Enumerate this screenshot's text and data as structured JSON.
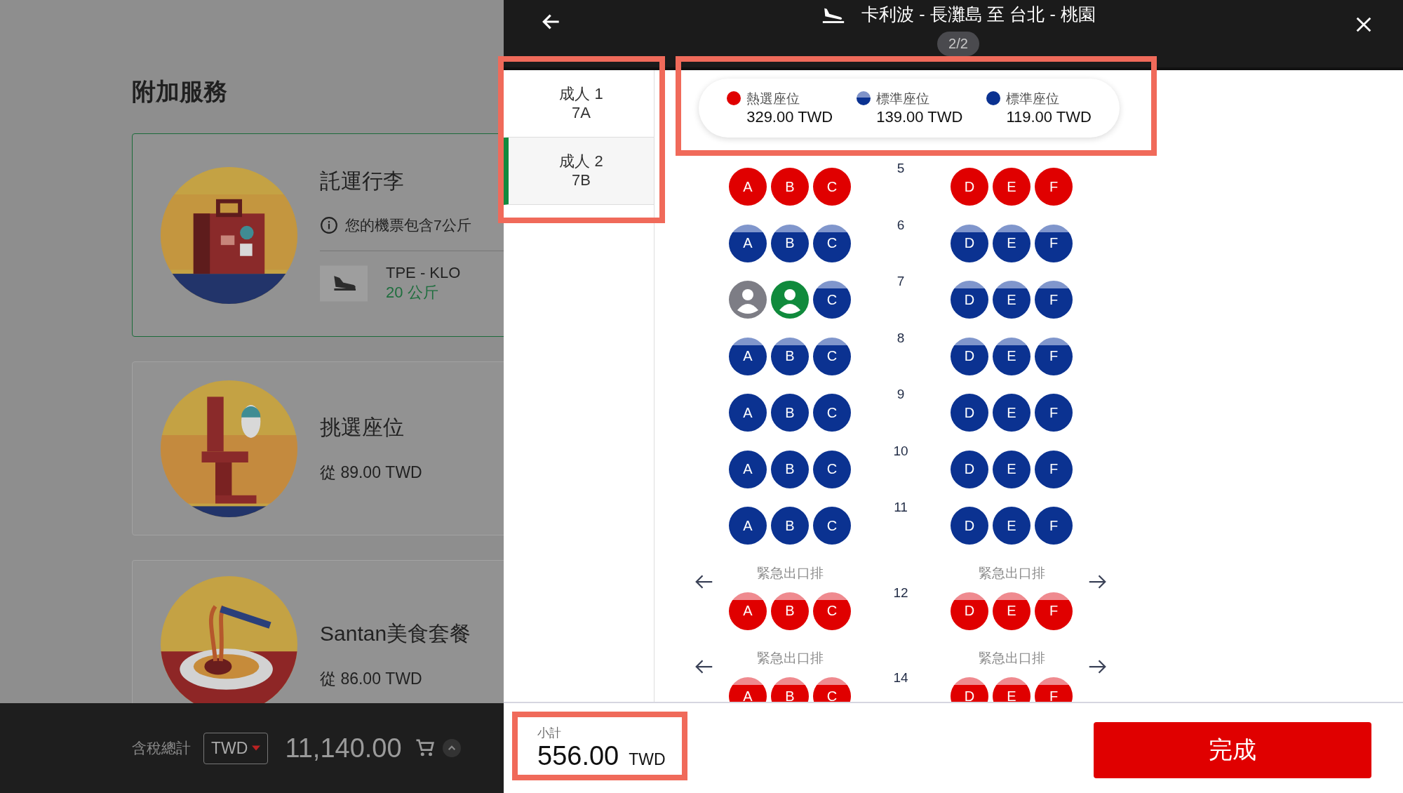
{
  "addons": {
    "title": "附加服務",
    "cards": [
      {
        "kind": "baggage",
        "selected": true,
        "title": "託運行李",
        "info": "您的機票包含7公斤",
        "route": "TPE - KLO",
        "weight": "20 公斤"
      },
      {
        "kind": "seat",
        "selected": false,
        "title": "挑選座位",
        "price": "從 89.00 TWD"
      },
      {
        "kind": "meal",
        "selected": false,
        "title": "Santan美食套餐",
        "price": "從 86.00 TWD"
      }
    ],
    "total_bar": {
      "label": "含稅總計",
      "currency": "TWD",
      "amount": "11,140.00"
    }
  },
  "seat_panel": {
    "title": "卡利波 - 長灘島 至 台北 - 桃園",
    "page": "2/2",
    "passengers": [
      {
        "label": "成人 1",
        "seat": "7A",
        "selected": false
      },
      {
        "label": "成人 2",
        "seat": "7B",
        "selected": true
      }
    ],
    "legend": [
      {
        "kind": "hot",
        "label": "熱選座位",
        "price": "329.00 TWD"
      },
      {
        "kind": "standard-plus",
        "label": "標準座位",
        "price": "139.00 TWD"
      },
      {
        "kind": "standard",
        "label": "標準座位",
        "price": "119.00 TWD"
      }
    ],
    "rows": [
      {
        "kind": "seats",
        "number": "5",
        "seats": [
          {
            "letter": "A",
            "kind": "hot"
          },
          {
            "letter": "B",
            "kind": "hot"
          },
          {
            "letter": "C",
            "kind": "hot"
          },
          {
            "letter": "D",
            "kind": "hot"
          },
          {
            "letter": "E",
            "kind": "hot"
          },
          {
            "letter": "F",
            "kind": "hot"
          }
        ]
      },
      {
        "kind": "seats",
        "number": "6",
        "seats": [
          {
            "letter": "A",
            "kind": "standard-plus"
          },
          {
            "letter": "B",
            "kind": "standard-plus"
          },
          {
            "letter": "C",
            "kind": "standard-plus"
          },
          {
            "letter": "D",
            "kind": "standard-plus"
          },
          {
            "letter": "E",
            "kind": "standard-plus"
          },
          {
            "letter": "F",
            "kind": "standard-plus"
          }
        ]
      },
      {
        "kind": "seats",
        "number": "7",
        "seats": [
          {
            "kind": "assigned"
          },
          {
            "kind": "current"
          },
          {
            "letter": "C",
            "kind": "standard-plus"
          },
          {
            "letter": "D",
            "kind": "standard-plus"
          },
          {
            "letter": "E",
            "kind": "standard-plus"
          },
          {
            "letter": "F",
            "kind": "standard-plus"
          }
        ]
      },
      {
        "kind": "seats",
        "number": "8",
        "seats": [
          {
            "letter": "A",
            "kind": "standard-plus"
          },
          {
            "letter": "B",
            "kind": "standard-plus"
          },
          {
            "letter": "C",
            "kind": "standard-plus"
          },
          {
            "letter": "D",
            "kind": "standard-plus"
          },
          {
            "letter": "E",
            "kind": "standard-plus"
          },
          {
            "letter": "F",
            "kind": "standard-plus"
          }
        ]
      },
      {
        "kind": "seats",
        "number": "9",
        "seats": [
          {
            "letter": "A",
            "kind": "standard"
          },
          {
            "letter": "B",
            "kind": "standard"
          },
          {
            "letter": "C",
            "kind": "standard"
          },
          {
            "letter": "D",
            "kind": "standard"
          },
          {
            "letter": "E",
            "kind": "standard"
          },
          {
            "letter": "F",
            "kind": "standard"
          }
        ]
      },
      {
        "kind": "seats",
        "number": "10",
        "seats": [
          {
            "letter": "A",
            "kind": "standard"
          },
          {
            "letter": "B",
            "kind": "standard"
          },
          {
            "letter": "C",
            "kind": "standard"
          },
          {
            "letter": "D",
            "kind": "standard"
          },
          {
            "letter": "E",
            "kind": "standard"
          },
          {
            "letter": "F",
            "kind": "standard"
          }
        ]
      },
      {
        "kind": "seats",
        "number": "11",
        "seats": [
          {
            "letter": "A",
            "kind": "standard"
          },
          {
            "letter": "B",
            "kind": "standard"
          },
          {
            "letter": "C",
            "kind": "standard"
          },
          {
            "letter": "D",
            "kind": "standard"
          },
          {
            "letter": "E",
            "kind": "standard"
          },
          {
            "letter": "F",
            "kind": "standard"
          }
        ]
      },
      {
        "kind": "exit",
        "left_label": "緊急出口排",
        "right_label": "緊急出口排"
      },
      {
        "kind": "seats",
        "number": "12",
        "seats": [
          {
            "letter": "A",
            "kind": "hot-plus"
          },
          {
            "letter": "B",
            "kind": "hot-plus"
          },
          {
            "letter": "C",
            "kind": "hot-plus"
          },
          {
            "letter": "D",
            "kind": "hot-plus"
          },
          {
            "letter": "E",
            "kind": "hot-plus"
          },
          {
            "letter": "F",
            "kind": "hot-plus"
          }
        ]
      },
      {
        "kind": "exit",
        "left_label": "緊急出口排",
        "right_label": "緊急出口排"
      },
      {
        "kind": "seats",
        "number": "14",
        "seats": [
          {
            "letter": "A",
            "kind": "hot-plus"
          },
          {
            "letter": "B",
            "kind": "hot-plus"
          },
          {
            "letter": "C",
            "kind": "hot-plus"
          },
          {
            "letter": "D",
            "kind": "hot-plus"
          },
          {
            "letter": "E",
            "kind": "hot-plus"
          },
          {
            "letter": "F",
            "kind": "hot-plus"
          }
        ]
      }
    ],
    "subtotal": {
      "label": "小計",
      "amount": "556.00",
      "currency": "TWD"
    },
    "done_button": "完成"
  }
}
